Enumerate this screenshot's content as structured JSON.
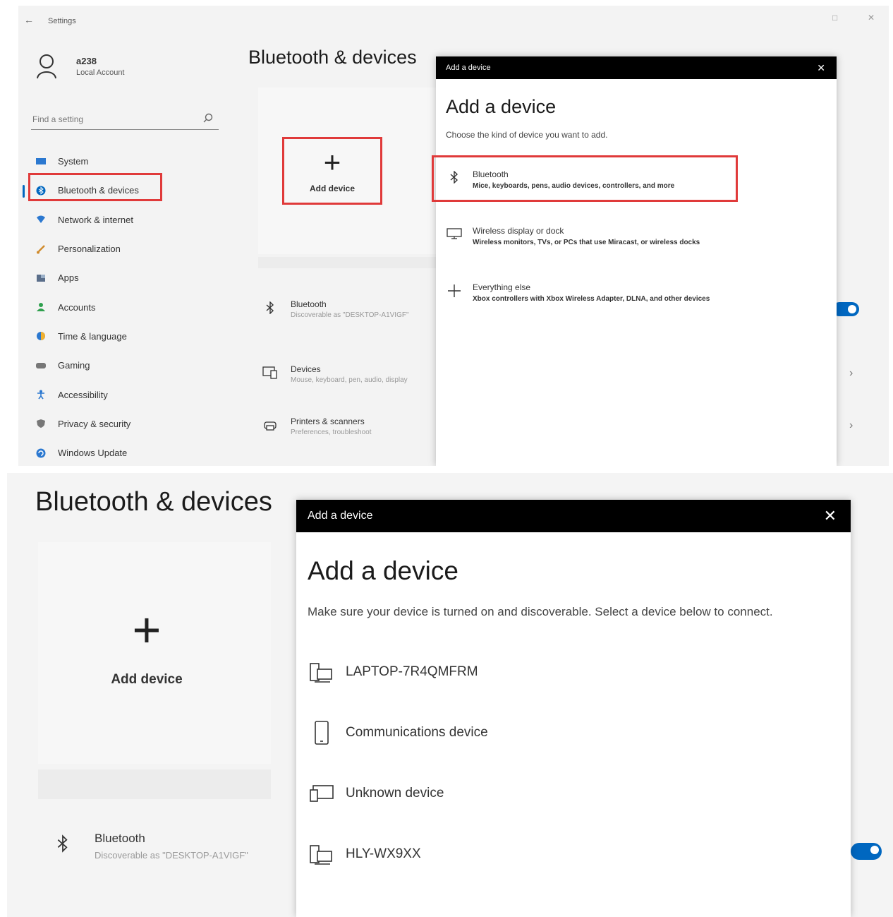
{
  "top": {
    "titlebar": {
      "back": "←",
      "app_title": "Settings",
      "maximize": "□",
      "close": "✕"
    },
    "user": {
      "name": "a238",
      "type": "Local Account"
    },
    "search": {
      "placeholder": "Find a setting"
    },
    "nav": [
      {
        "label": "System",
        "icon": "system-icon",
        "color": "#2b78d0"
      },
      {
        "label": "Bluetooth & devices",
        "icon": "bluetooth-nav-icon",
        "color": "#0067c0",
        "active": true
      },
      {
        "label": "Network & internet",
        "icon": "network-icon",
        "color": "#2b78d0"
      },
      {
        "label": "Personalization",
        "icon": "brush-icon",
        "color": "#d08a2b"
      },
      {
        "label": "Apps",
        "icon": "apps-icon",
        "color": "#5a6e8a"
      },
      {
        "label": "Accounts",
        "icon": "accounts-icon",
        "color": "#2fa04e"
      },
      {
        "label": "Time & language",
        "icon": "globe-icon",
        "color": "#2b78d0"
      },
      {
        "label": "Gaming",
        "icon": "gaming-icon",
        "color": "#777777"
      },
      {
        "label": "Accessibility",
        "icon": "accessibility-icon",
        "color": "#2b78d0"
      },
      {
        "label": "Privacy & security",
        "icon": "shield-icon",
        "color": "#777777"
      },
      {
        "label": "Windows Update",
        "icon": "update-icon",
        "color": "#2b78d0"
      }
    ],
    "page_title": "Bluetooth & devices",
    "add_device": {
      "label": "Add device",
      "plus": "+"
    },
    "rows": [
      {
        "title": "Bluetooth",
        "subtitle": "Discoverable as \"DESKTOP-A1VIGF\"",
        "icon": "bluetooth-icon"
      },
      {
        "title": "Devices",
        "subtitle": "Mouse, keyboard, pen, audio, display",
        "icon": "devices-icon"
      },
      {
        "title": "Printers & scanners",
        "subtitle": "Preferences, troubleshoot",
        "icon": "printer-icon"
      }
    ],
    "dialog": {
      "bar_title": "Add a device",
      "close": "✕",
      "heading": "Add a device",
      "subtitle": "Choose the kind of device you want to add.",
      "options": [
        {
          "title": "Bluetooth",
          "desc": "Mice, keyboards, pens, audio devices, controllers, and more",
          "icon": "bluetooth-icon"
        },
        {
          "title": "Wireless display or dock",
          "desc": "Wireless monitors, TVs, or PCs that use Miracast, or wireless docks",
          "icon": "monitor-icon"
        },
        {
          "title": "Everything else",
          "desc": "Xbox controllers with Xbox Wireless Adapter, DLNA, and other devices",
          "icon": "plus-icon"
        }
      ]
    }
  },
  "bottom": {
    "page_title": "Bluetooth & devices",
    "add_device": {
      "label": "Add device",
      "plus": "+"
    },
    "bluetooth_row": {
      "title": "Bluetooth",
      "subtitle": "Discoverable as \"DESKTOP-A1VIGF\""
    },
    "dialog": {
      "bar_title": "Add a device",
      "close": "✕",
      "heading": "Add a device",
      "subtitle": "Make sure your device is turned on and discoverable. Select a device below to connect.",
      "devices": [
        {
          "name": "LAPTOP-7R4QMFRM",
          "icon": "computer-icon"
        },
        {
          "name": "Communications device",
          "icon": "phone-icon"
        },
        {
          "name": "Unknown device",
          "icon": "unknown-device-icon"
        },
        {
          "name": "HLY-WX9XX",
          "icon": "computer-icon"
        }
      ]
    }
  },
  "colors": {
    "accent": "#0067c0",
    "highlight": "#e03a3a",
    "dialog_bar": "#000000"
  }
}
